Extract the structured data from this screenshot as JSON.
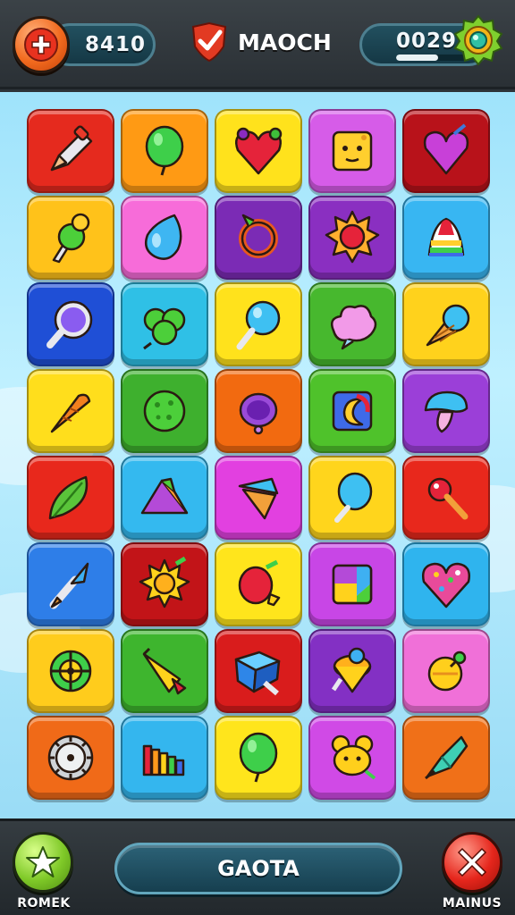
{
  "header": {
    "score_left": "8410",
    "match_label": "MAOCH",
    "score_right": "0029",
    "progress_fraction": 0.6,
    "add_icon": "plus-icon",
    "match_icon": "checkmark-shield-icon",
    "gem_icon": "gem-badge-icon"
  },
  "board": {
    "rows": [
      [
        {
          "name": "rocket-pencil",
          "bg": "#e52a1e"
        },
        {
          "name": "green-balloon",
          "bg": "#ff9a14"
        },
        {
          "name": "red-heart-gem",
          "bg": "#ffe21c"
        },
        {
          "name": "cheese-face-block",
          "bg": "#d65ce8"
        },
        {
          "name": "purple-heart",
          "bg": "#b8121a"
        }
      ],
      [
        {
          "name": "green-ice-cream",
          "bg": "#ffc21a"
        },
        {
          "name": "blue-drop",
          "bg": "#f76cd9"
        },
        {
          "name": "ring-arrow",
          "bg": "#7b2bb5"
        },
        {
          "name": "red-sun",
          "bg": "#8a2fc1"
        },
        {
          "name": "striped-cone",
          "bg": "#38b6f2"
        }
      ],
      [
        {
          "name": "magnifier",
          "bg": "#1f4fd6"
        },
        {
          "name": "green-clover",
          "bg": "#2fc0e6"
        },
        {
          "name": "blue-lollipop",
          "bg": "#ffe21c"
        },
        {
          "name": "pink-cloud",
          "bg": "#47b82e"
        },
        {
          "name": "ice-cream-cone",
          "bg": "#ffd21c"
        }
      ],
      [
        {
          "name": "carrot",
          "bg": "#ffde1c"
        },
        {
          "name": "green-ball",
          "bg": "#3eb02e"
        },
        {
          "name": "purple-mirror",
          "bg": "#f26a10"
        },
        {
          "name": "moon-square",
          "bg": "#4fc22b"
        },
        {
          "name": "blue-mushroom",
          "bg": "#9b3fd8"
        }
      ],
      [
        {
          "name": "green-leaf",
          "bg": "#e8281c"
        },
        {
          "name": "purple-pyramid",
          "bg": "#34b9ef"
        },
        {
          "name": "orange-cone",
          "bg": "#e240e0"
        },
        {
          "name": "blue-balloon",
          "bg": "#ffd51c"
        },
        {
          "name": "red-key",
          "bg": "#e8281c"
        }
      ],
      [
        {
          "name": "paint-brush",
          "bg": "#2e7ee8"
        },
        {
          "name": "yellow-sun",
          "bg": "#c21418"
        },
        {
          "name": "red-berry",
          "bg": "#ffe51c"
        },
        {
          "name": "color-square",
          "bg": "#c846e6"
        },
        {
          "name": "candy-heart",
          "bg": "#2fb4ee"
        }
      ],
      [
        {
          "name": "target-wheel",
          "bg": "#ffcc1c"
        },
        {
          "name": "yellow-horn",
          "bg": "#3eb52e"
        },
        {
          "name": "blue-cube",
          "bg": "#d91c1c"
        },
        {
          "name": "spinning-top",
          "bg": "#8330c4"
        },
        {
          "name": "yellow-orb",
          "bg": "#f070d8"
        }
      ],
      [
        {
          "name": "gear-wheel",
          "bg": "#f06a18"
        },
        {
          "name": "rainbow-stairs",
          "bg": "#34b6ee"
        },
        {
          "name": "green-balloon",
          "bg": "#ffe51c"
        },
        {
          "name": "golden-mouse",
          "bg": "#d04ae6"
        },
        {
          "name": "teal-gem",
          "bg": "#f07018"
        }
      ]
    ]
  },
  "footer": {
    "left_caption": "ROMEK",
    "main_button": "GAOTA",
    "right_caption": "MAINUS",
    "left_icon": "star-icon",
    "right_icon": "close-icon"
  }
}
